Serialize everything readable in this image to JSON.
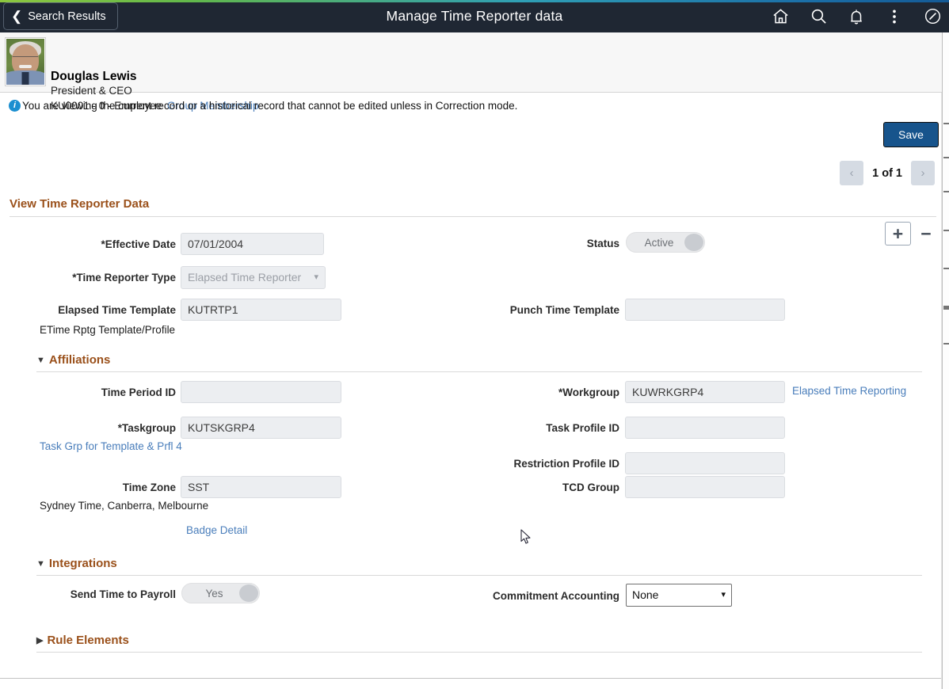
{
  "header": {
    "back_label": "Search Results",
    "title": "Manage Time Reporter data",
    "icons": [
      "home-icon",
      "search-icon",
      "notifications-bell-icon",
      "actions-menu-icon",
      "navbar-compass-icon"
    ]
  },
  "person": {
    "name": "Douglas Lewis",
    "job_title": "President & CEO",
    "identifier": "KU0001 - 0 - Employee",
    "group_membership_link": "Group Membership"
  },
  "message": {
    "text": "You are viewing the current record or a historical record that cannot be edited unless in Correction mode."
  },
  "actions": {
    "save_label": "Save",
    "prev_label": "‹",
    "next_label": "›",
    "page_count": "1 of 1",
    "add_row_label": "+",
    "delete_row_label": "−"
  },
  "sections": {
    "main": {
      "title": "View Time Reporter Data",
      "fields": {
        "effective_date": {
          "label": "Effective Date",
          "value": "07/01/2004",
          "required": true
        },
        "time_reporter_type": {
          "label": "Time Reporter Type",
          "value": "Elapsed Time Reporter",
          "required": true
        },
        "elapsed_time_template": {
          "label": "Elapsed Time Template",
          "value": "KUTRTP1",
          "required": false
        },
        "elapsed_time_template_desc": "ETime Rptg Template/Profile",
        "status": {
          "label": "Status",
          "value": "Active"
        },
        "punch_time_template": {
          "label": "Punch Time Template",
          "value": ""
        }
      }
    },
    "affiliations": {
      "title": "Affiliations",
      "expanded": true,
      "fields": {
        "time_period_id": {
          "label": "Time Period ID",
          "value": ""
        },
        "taskgroup": {
          "label": "Taskgroup",
          "value": "KUTSKGRP4",
          "required": true
        },
        "taskgroup_link": "Task Grp for Template & Prfl 4",
        "time_zone": {
          "label": "Time Zone",
          "value": "SST"
        },
        "time_zone_desc": "Sydney Time, Canberra, Melbourne",
        "badge_detail_link": "Badge Detail",
        "workgroup": {
          "label": "Workgroup",
          "value": "KUWRKGRP4",
          "required": true
        },
        "workgroup_link": "Elapsed Time Reporting",
        "task_profile_id": {
          "label": "Task Profile ID",
          "value": ""
        },
        "restriction_profile_id": {
          "label": "Restriction Profile ID",
          "value": ""
        },
        "tcd_group": {
          "label": "TCD Group",
          "value": ""
        }
      }
    },
    "integrations": {
      "title": "Integrations",
      "expanded": true,
      "fields": {
        "send_time_to_payroll": {
          "label": "Send Time to Payroll",
          "value": "Yes"
        },
        "commitment_accounting": {
          "label": "Commitment Accounting",
          "value": "None"
        }
      }
    },
    "rule_elements": {
      "title": "Rule Elements",
      "expanded": false
    }
  },
  "colors": {
    "header_bg": "#1f2733",
    "section_heading": "#9a501a",
    "link": "#4a7ebb",
    "save_button": "#17548c",
    "info_icon": "#1c8fd0"
  }
}
